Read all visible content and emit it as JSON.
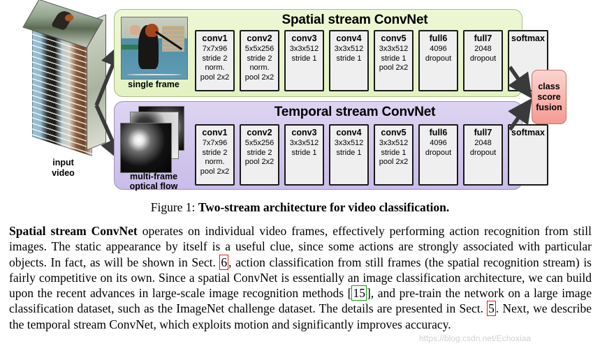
{
  "figure": {
    "input": {
      "label": "input\nvideo",
      "label_line1": "input",
      "label_line2": "video"
    },
    "streams": [
      {
        "id": "spatial",
        "title": "Spatial stream ConvNet",
        "input_label_line1": "single frame",
        "input_label_line2": "",
        "input_icon": "single-video-frame-thumbnail",
        "panel_color": "#e4f2c2",
        "layers": [
          {
            "name": "conv1",
            "specs": [
              "7x7x96",
              "stride 2",
              "norm.",
              "pool 2x2"
            ]
          },
          {
            "name": "conv2",
            "specs": [
              "5x5x256",
              "stride 2",
              "norm.",
              "pool 2x2"
            ]
          },
          {
            "name": "conv3",
            "specs": [
              "3x3x512",
              "stride 1"
            ]
          },
          {
            "name": "conv4",
            "specs": [
              "3x3x512",
              "stride 1"
            ]
          },
          {
            "name": "conv5",
            "specs": [
              "3x3x512",
              "stride 1",
              "pool 2x2"
            ]
          },
          {
            "name": "full6",
            "specs": [
              "4096",
              "dropout"
            ]
          },
          {
            "name": "full7",
            "specs": [
              "2048",
              "dropout"
            ]
          },
          {
            "name": "softmax",
            "specs": []
          }
        ]
      },
      {
        "id": "temporal",
        "title": "Temporal stream ConvNet",
        "input_label_line1": "multi-frame",
        "input_label_line2": "optical flow",
        "input_icon": "stacked-optical-flow-thumbnails",
        "panel_color": "#c9bce9",
        "layers": [
          {
            "name": "conv1",
            "specs": [
              "7x7x96",
              "stride 2",
              "norm.",
              "pool 2x2"
            ]
          },
          {
            "name": "conv2",
            "specs": [
              "5x5x256",
              "stride 2",
              "pool 2x2"
            ]
          },
          {
            "name": "conv3",
            "specs": [
              "3x3x512",
              "stride 1"
            ]
          },
          {
            "name": "conv4",
            "specs": [
              "3x3x512",
              "stride 1"
            ]
          },
          {
            "name": "conv5",
            "specs": [
              "3x3x512",
              "stride 1",
              "pool 2x2"
            ]
          },
          {
            "name": "full6",
            "specs": [
              "4096",
              "dropout"
            ]
          },
          {
            "name": "full7",
            "specs": [
              "2048",
              "dropout"
            ]
          },
          {
            "name": "softmax",
            "specs": []
          }
        ]
      }
    ],
    "fusion": {
      "line1": "class",
      "line2": "score",
      "line3": "fusion",
      "color": "#f49b92"
    }
  },
  "caption": {
    "lead": "Figure 1: ",
    "bold": "Two-stream architecture for video classification."
  },
  "body": {
    "lead_bold": "Spatial stream ConvNet",
    "seg1": " operates on individual video frames, effectively performing action recognition from still images. The static appearance by itself is a useful clue, since some actions are strongly associated with particular objects. In fact, as will be shown in Sect. ",
    "ref_sect6": "6",
    "seg2": ", action classification from still frames (the spatial recognition stream) is fairly competitive on its own. Since a spatial ConvNet is essentially an image classification architecture, we can build upon the recent advances in large-scale image recognition methods [",
    "ref_15": "15",
    "seg3": "], and pre-train the network on a large image classification dataset, such as the ImageNet challenge dataset. The details are presented in Sect. ",
    "ref_sect5": "5",
    "seg4": ". Next, we describe the temporal stream ConvNet, which exploits motion and significantly improves accuracy.",
    "watermark": "https://blog.csdn.net/Echoxiaa"
  },
  "colors": {
    "spatial_panel": "#e4f2c2",
    "temporal_panel": "#c9bce9",
    "fusion_box": "#f49b92",
    "layer_box": "#efefef",
    "link_red": "#e01b1b",
    "link_green": "#10a010"
  }
}
